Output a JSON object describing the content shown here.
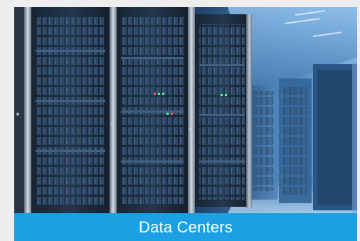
{
  "tile": {
    "image_subject": "server-racks-photo",
    "caption": "Data Centers",
    "caption_bar_color": "#1aa0e3",
    "caption_text_color": "#ffffff",
    "page_background": "#eeeeee"
  }
}
